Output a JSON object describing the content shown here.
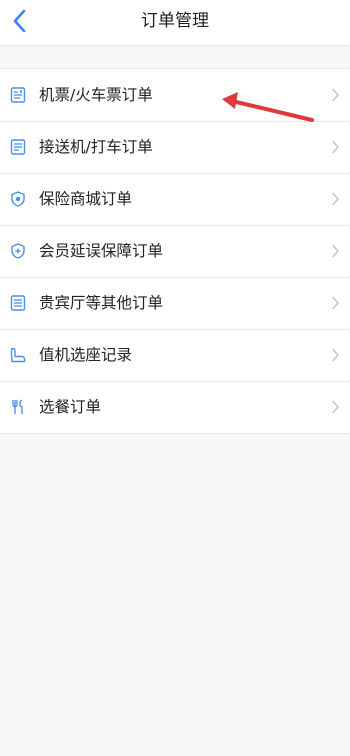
{
  "header": {
    "title": "订单管理",
    "back_icon": "chevron-left-icon"
  },
  "colors": {
    "accent": "#3b82f6",
    "icon_blue": "#4a90e2",
    "annotation_red": "#e0393b"
  },
  "menu": {
    "items": [
      {
        "label": "机票/火车票订单",
        "icon": "ticket-icon"
      },
      {
        "label": "接送机/打车订单",
        "icon": "receipt-icon"
      },
      {
        "label": "保险商城订单",
        "icon": "shield-icon"
      },
      {
        "label": "会员延误保障订单",
        "icon": "shield-plus-icon"
      },
      {
        "label": "贵宾厅等其他订单",
        "icon": "document-icon"
      },
      {
        "label": "值机选座记录",
        "icon": "seat-icon"
      },
      {
        "label": "选餐订单",
        "icon": "utensils-icon"
      }
    ]
  }
}
